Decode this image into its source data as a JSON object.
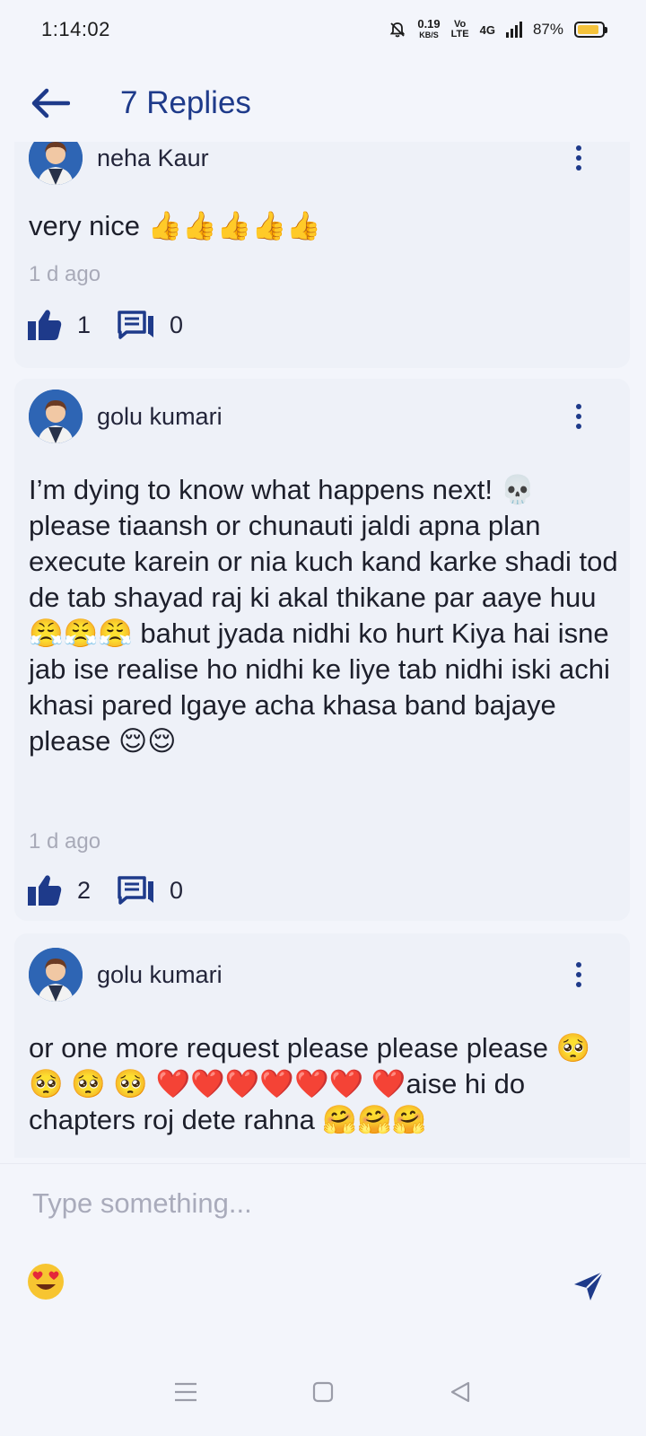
{
  "status_bar": {
    "time": "1:14:02",
    "speed_value": "0.19",
    "speed_unit": "KB/S",
    "volte_top": "Vo",
    "volte_bottom": "LTE",
    "network": "4G",
    "battery_percent": "87%",
    "battery_level": 0.87
  },
  "header": {
    "back_icon": "arrow-left-icon",
    "title": "7 Replies"
  },
  "comments": [
    {
      "author": "neha Kaur",
      "text": "very nice 👍👍👍👍👍",
      "time": "1 d ago",
      "likes": "1",
      "replies": "0"
    },
    {
      "author": "golu kumari",
      "text": "I’m dying to know what happens next! 💀 please tiaansh or chunauti jaldi apna plan execute karein or nia kuch kand karke shadi tod de tab shayad raj ki akal thikane par aaye huu😤😤😤 bahut jyada nidhi ko hurt Kiya hai isne jab ise realise ho nidhi ke liye tab nidhi iski achi khasi pared lgaye acha khasa band bajaye please 😌😌",
      "time": "1 d ago",
      "likes": "2",
      "replies": "0"
    },
    {
      "author": "golu kumari",
      "text": "or one more request please please please 🥺 🥺 🥺 🥺 ❤️❤️❤️❤️❤️❤️ ❤️aise hi do chapters roj dete rahna 🤗🤗🤗"
    }
  ],
  "composer": {
    "placeholder": "Type something...",
    "emoji": "😍",
    "emoji_icon": "heart-eyes-emoji-icon",
    "send_icon": "send-icon"
  },
  "colors": {
    "accent": "#1e3a8a",
    "card_bg": "#eef1f8",
    "page_bg": "#f3f5fb",
    "muted_text": "#a8aab8"
  }
}
